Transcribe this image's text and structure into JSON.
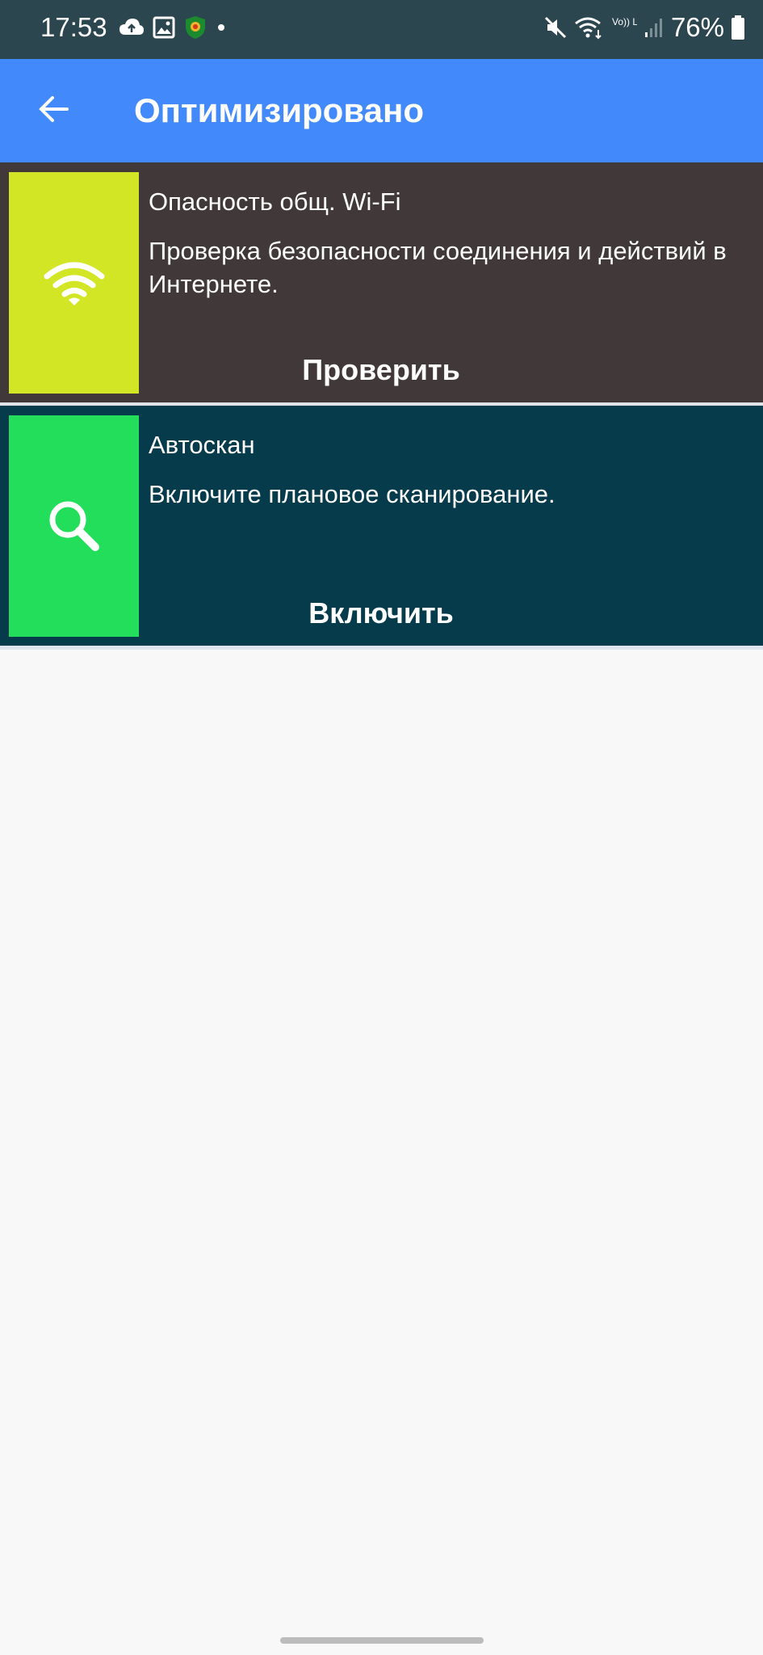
{
  "status_bar": {
    "time": "17:53",
    "battery": "76%",
    "network_label": "Vo)) LTE1"
  },
  "app_bar": {
    "title": "Оптимизировано",
    "back_icon": "back-arrow-icon"
  },
  "cards": [
    {
      "title": "Опасность общ. Wi-Fi",
      "description": "Проверка безопасности соединения и действий в Интернете.",
      "action": "Проверить",
      "icon": "wifi-icon",
      "tile_color": "#d2e626",
      "bg_color": "#403839"
    },
    {
      "title": "Автоскан",
      "description": "Включите плановое сканирование.",
      "action": "Включить",
      "icon": "search-icon",
      "tile_color": "#22de5a",
      "bg_color": "#053b4b"
    }
  ],
  "colors": {
    "app_bar": "#4289fb",
    "status_bar": "#2c4650",
    "background": "#f8f8f9"
  }
}
